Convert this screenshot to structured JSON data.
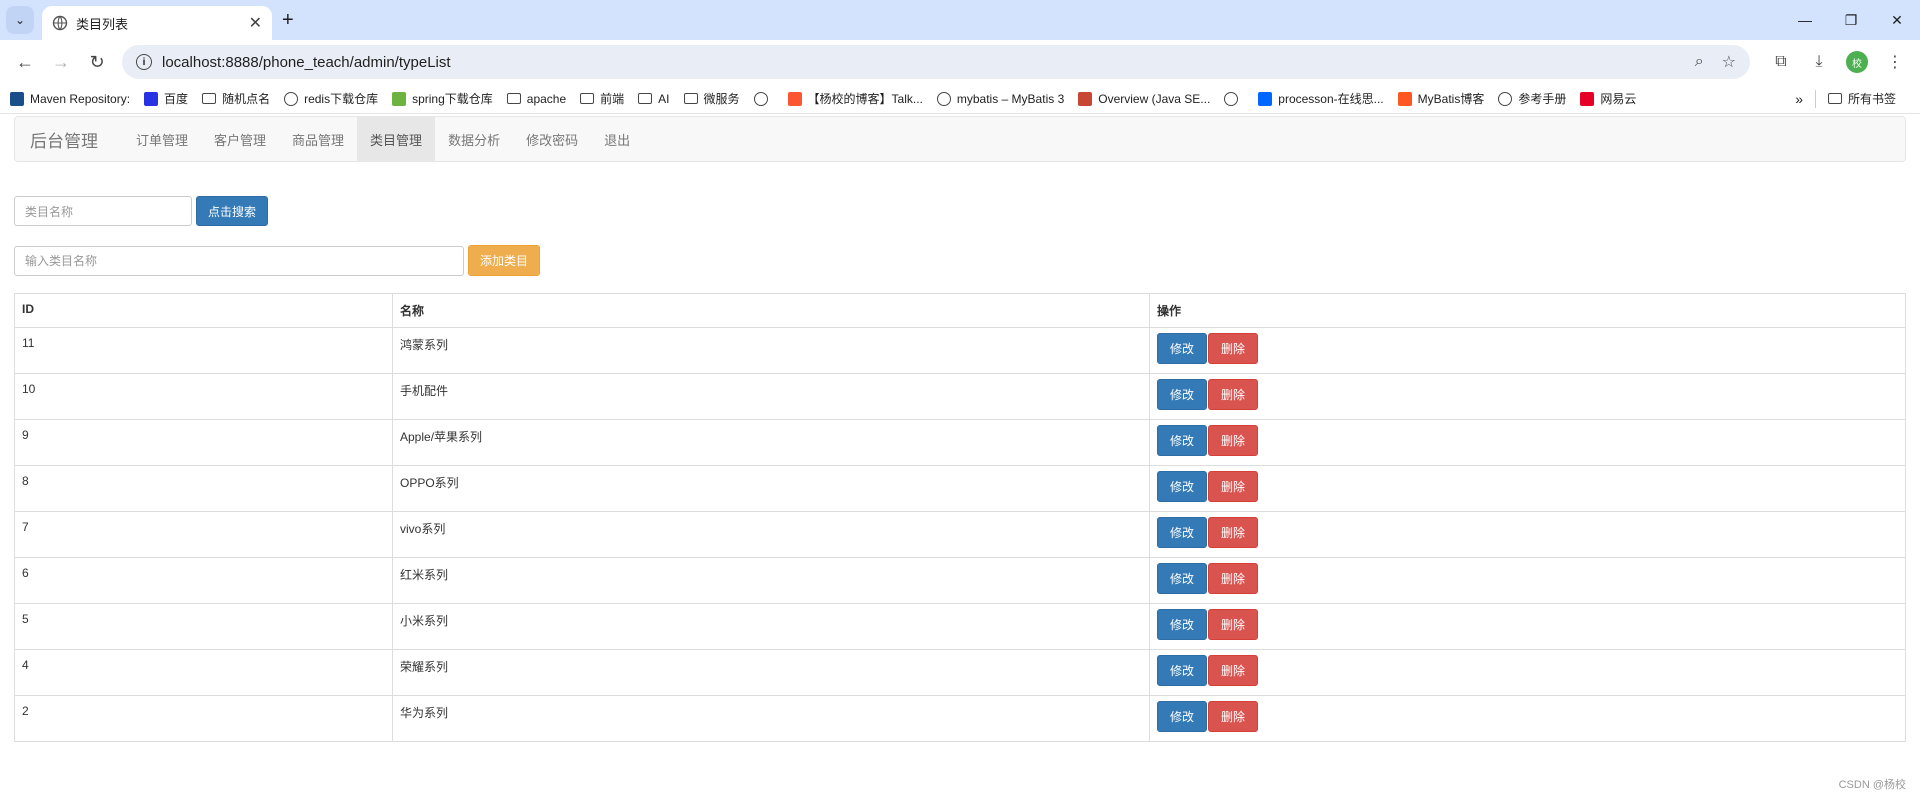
{
  "browser": {
    "tab_title": "类目列表",
    "url": "localhost:8888/phone_teach/admin/typeList",
    "avatar_initial": "校",
    "bookmarks": [
      {
        "label": "Maven Repository:",
        "icon": "maven-icon"
      },
      {
        "label": "百度",
        "icon": "baidu-icon"
      },
      {
        "label": "随机点名",
        "icon": "folder-icon"
      },
      {
        "label": "redis下载仓库",
        "icon": "globe-icon"
      },
      {
        "label": "spring下载仓库",
        "icon": "spring-icon"
      },
      {
        "label": "apache",
        "icon": "folder-icon"
      },
      {
        "label": "前端",
        "icon": "folder-icon"
      },
      {
        "label": "AI",
        "icon": "folder-icon"
      },
      {
        "label": "微服务",
        "icon": "folder-icon"
      },
      {
        "label": "",
        "icon": "globe-icon"
      },
      {
        "label": "【杨校的博客】Talk...",
        "icon": "csdn-icon"
      },
      {
        "label": "mybatis – MyBatis 3",
        "icon": "globe-icon"
      },
      {
        "label": "Overview (Java SE...",
        "icon": "oracle-icon"
      },
      {
        "label": "",
        "icon": "globe-icon"
      },
      {
        "label": "processon-在线思...",
        "icon": "processon-icon"
      },
      {
        "label": "MyBatis博客",
        "icon": "blogger-icon"
      },
      {
        "label": "参考手册",
        "icon": "globe-icon"
      },
      {
        "label": "网易云",
        "icon": "netease-icon"
      }
    ],
    "all_bookmarks_label": "所有书签",
    "more_label": "»"
  },
  "nav": {
    "brand": "后台管理",
    "links": [
      "订单管理",
      "客户管理",
      "商品管理",
      "类目管理",
      "数据分析",
      "修改密码",
      "退出"
    ],
    "active_index": 3
  },
  "search": {
    "placeholder": "类目名称",
    "button_label": "点击搜索"
  },
  "add": {
    "placeholder": "输入类目名称",
    "button_label": "添加类目"
  },
  "table": {
    "headers": [
      "ID",
      "名称",
      "操作"
    ],
    "rows": [
      {
        "id": "11",
        "name": "鸿蒙系列"
      },
      {
        "id": "10",
        "name": "手机配件"
      },
      {
        "id": "9",
        "name": "Apple/苹果系列"
      },
      {
        "id": "8",
        "name": "OPPO系列"
      },
      {
        "id": "7",
        "name": "vivo系列"
      },
      {
        "id": "6",
        "name": "红米系列"
      },
      {
        "id": "5",
        "name": "小米系列"
      },
      {
        "id": "4",
        "name": "荣耀系列"
      },
      {
        "id": "2",
        "name": "华为系列"
      }
    ],
    "edit_label": "修改",
    "delete_label": "删除"
  },
  "watermark": "CSDN @杨校",
  "colors": {
    "primary": "#337ab7",
    "warning": "#f0ad4e",
    "danger": "#d9534f",
    "tabstrip": "#d3e3fd"
  }
}
